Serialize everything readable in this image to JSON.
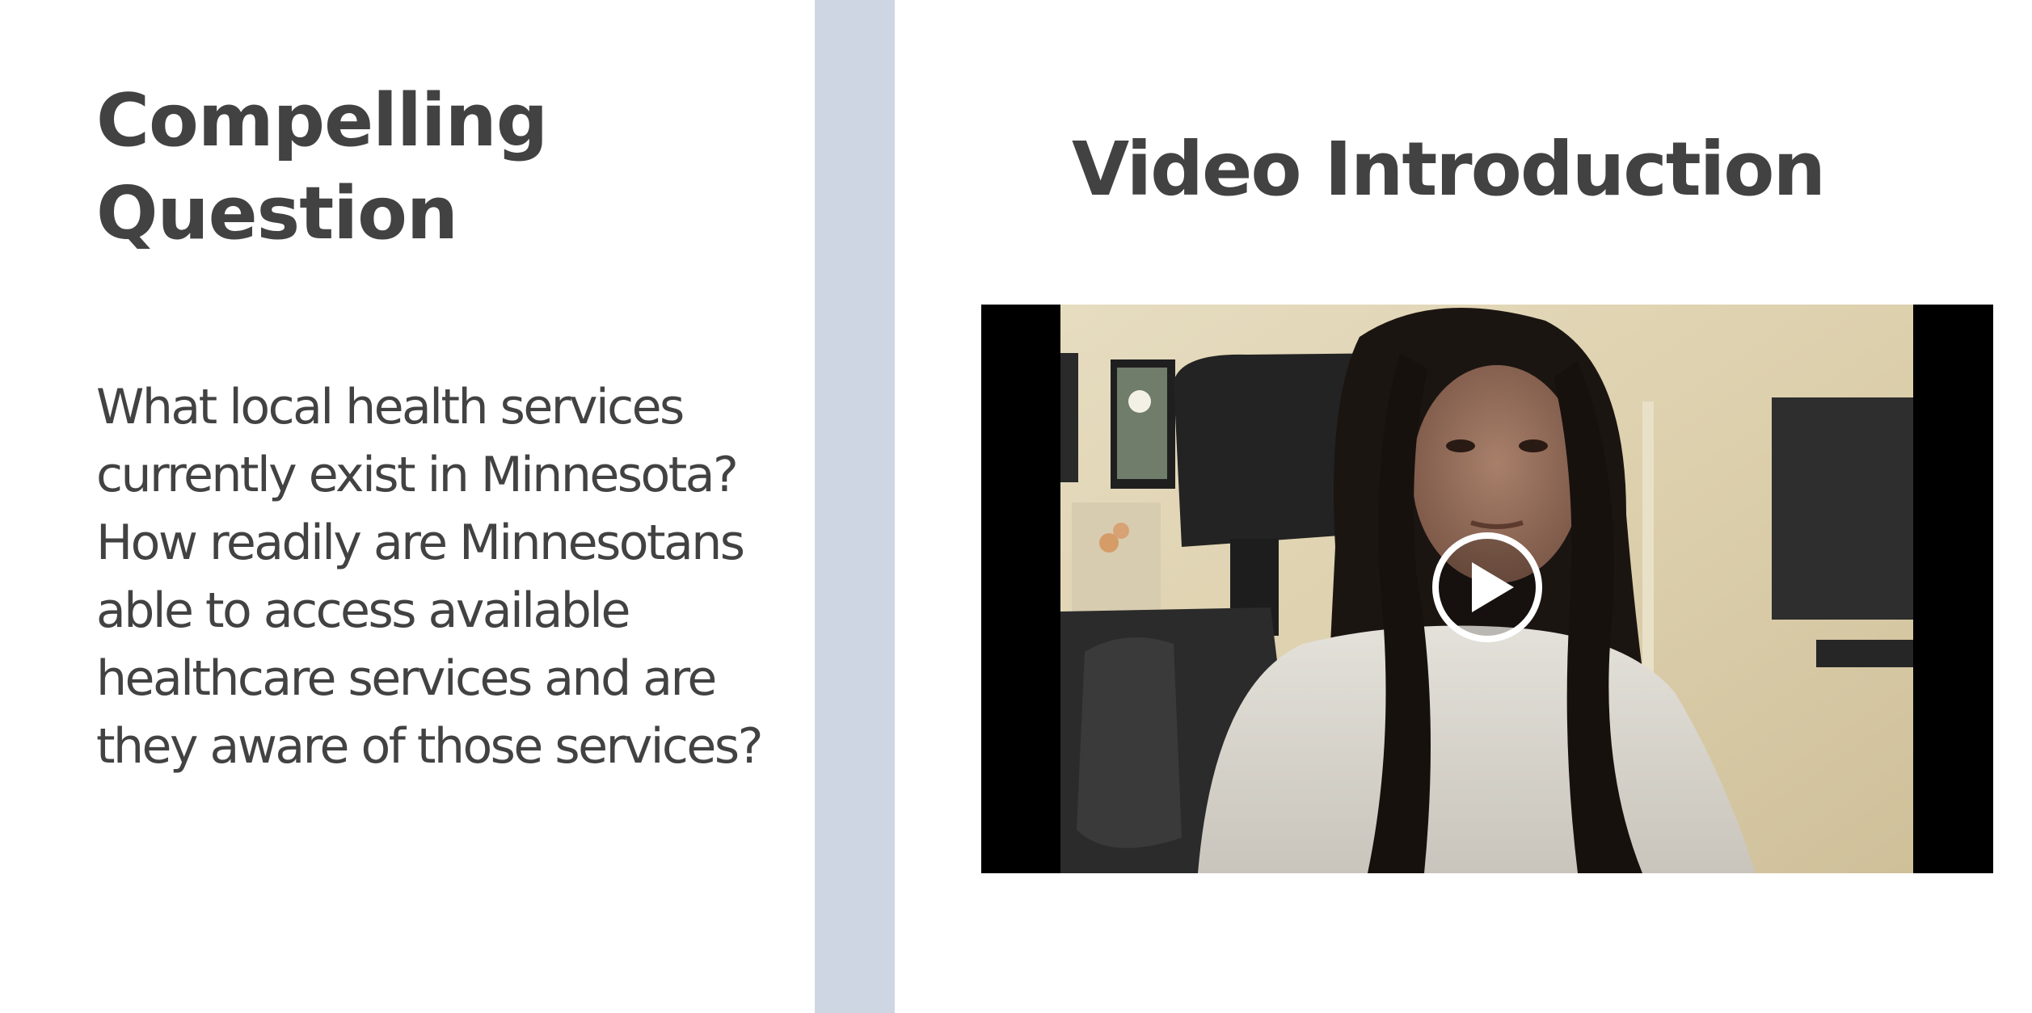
{
  "left": {
    "title": "Compelling Question",
    "body": "What local health services currently exist in Minnesota? How readily are Minnesotans able to access available healthcare services and are they aware of those services?"
  },
  "right": {
    "title": "Video Introduction"
  },
  "video": {
    "icon": "play-icon"
  },
  "colors": {
    "text": "#424242",
    "divider": "#cfd6e3",
    "background": "#ffffff",
    "video_letterbox": "#000000"
  }
}
